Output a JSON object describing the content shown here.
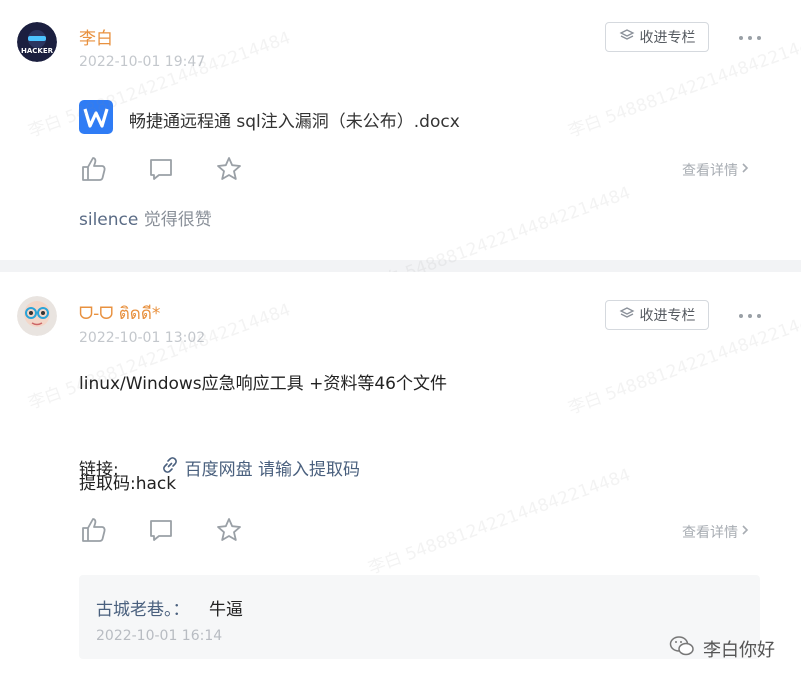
{
  "posts": [
    {
      "author": "李白",
      "time": "2022-10-01 19:47",
      "subscribe_label": "收进专栏",
      "file_name": "畅捷通远程通 sql注入漏洞（未公布）.docx",
      "detail_label": "查看详情",
      "likes": {
        "liker": "silence",
        "suffix": " 觉得很赞"
      },
      "avatar_text": "HACKER"
    },
    {
      "author": "ᗜ-ᗜ ติดดี*",
      "time": "2022-10-01 13:02",
      "subscribe_label": "收进专栏",
      "content_line1": "linux/Windows应急响应工具 +资料等46个文件",
      "link_prefix": "链接: ",
      "link_text": "百度网盘 请输入提取码",
      "code_line": "提取码:hack",
      "detail_label": "查看详情",
      "comment": {
        "author": "古城老巷。：",
        "text": "牛逼",
        "time": "2022-10-01 16:14"
      }
    }
  ],
  "watermark": {
    "repeat_text": "李白 5488812422144842214484",
    "brand_text": "李白你好"
  },
  "colors": {
    "author": "#e8913f",
    "link": "#4a607e",
    "file_icon": "#2f7cf5"
  }
}
